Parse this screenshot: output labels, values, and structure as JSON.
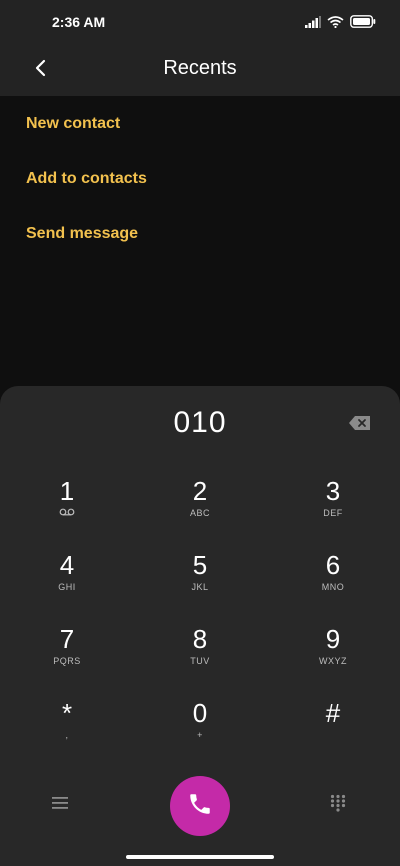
{
  "status_bar": {
    "time": "2:36 AM",
    "icons": [
      "signal-icon",
      "wifi-icon",
      "battery-icon"
    ]
  },
  "header": {
    "title": "Recents",
    "back_icon": "back-arrow-icon"
  },
  "actions": [
    {
      "label": "New contact"
    },
    {
      "label": "Add to contacts"
    },
    {
      "label": "Send message"
    }
  ],
  "dialer": {
    "number": "010",
    "keys": [
      {
        "digit": "1",
        "letters": ""
      },
      {
        "digit": "2",
        "letters": "ABC"
      },
      {
        "digit": "3",
        "letters": "DEF"
      },
      {
        "digit": "4",
        "letters": "GHI"
      },
      {
        "digit": "5",
        "letters": "JKL"
      },
      {
        "digit": "6",
        "letters": "MNO"
      },
      {
        "digit": "7",
        "letters": "PQRS"
      },
      {
        "digit": "8",
        "letters": "TUV"
      },
      {
        "digit": "9",
        "letters": "WXYZ"
      },
      {
        "digit": "*",
        "letters": ","
      },
      {
        "digit": "0",
        "letters": "+"
      },
      {
        "digit": "#",
        "letters": ""
      }
    ]
  },
  "colors": {
    "accent": "#f2c14e",
    "call_button": "#c42aa8",
    "dialer_bg": "#282828",
    "header_bg": "#232323"
  }
}
